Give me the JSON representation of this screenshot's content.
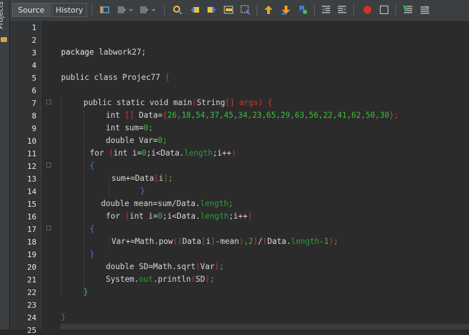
{
  "sidebar": {
    "label": "Projects"
  },
  "tabs": [
    {
      "label": "Source",
      "active": true
    },
    {
      "label": "History",
      "active": false
    }
  ],
  "toolbar_icons": [
    "last-edit-icon",
    "back-icon",
    "forward-icon",
    "find-selection-icon",
    "find-previous-icon",
    "find-next-icon",
    "toggle-highlight-icon",
    "toggle-rect-select-icon",
    "previous-bookmark-icon",
    "next-bookmark-icon",
    "toggle-bookmark-icon",
    "shift-left-icon",
    "shift-right-icon",
    "start-macro-icon",
    "stop-macro-icon",
    "comment-icon",
    "uncomment-icon"
  ],
  "line_numbers": [
    "1",
    "2",
    "3",
    "4",
    "5",
    "6",
    "7",
    "8",
    "9",
    "10",
    "11",
    "12",
    "13",
    "14",
    "15",
    "16",
    "17",
    "18",
    "19",
    "20",
    "21",
    "22",
    "23",
    "24",
    "25"
  ],
  "code": {
    "l3": {
      "kw": "package",
      "rest": " labwork27;"
    },
    "l5": {
      "a": "public class Projec77 ",
      "b": "{"
    },
    "l7": {
      "a": "public static void main",
      "b": "(",
      "c": "String",
      "d": "[]",
      "e": " args",
      "f": ")",
      "g": " {"
    },
    "l8": {
      "a": "int ",
      "b": "[]",
      "c": " Data=",
      "d": "{",
      "e": "26,18,54,37,45,34,23,65,29,63,56,22,41,62,50,30",
      "f": "};"
    },
    "l9": {
      "a": "int sum=",
      "b": "0",
      "c": ";"
    },
    "l10": {
      "a": "double Var=",
      "b": "0",
      "c": ";"
    },
    "l11": {
      "a": "for ",
      "b": "(",
      "c": "int i=",
      "d": "0",
      "e": ";i<Data.",
      "f": "length",
      "g": ";i++",
      "h": ")"
    },
    "l12": {
      "a": "{"
    },
    "l13": {
      "a": "sum+=Data",
      "b": "[",
      "c": "i",
      "d": "]",
      "e": ";"
    },
    "l14": {
      "a": "}"
    },
    "l15": {
      "a": "double mean=sum/Data.",
      "b": "length",
      "c": ";"
    },
    "l16": {
      "a": "for ",
      "b": "(",
      "c": "int i=",
      "d": "0",
      "e": ";i<Data.",
      "f": "length",
      "g": ";i++",
      "h": ")"
    },
    "l17": {
      "a": "{"
    },
    "l18": {
      "a": "Var+=Math.pow",
      "b": "((",
      "c": "Data",
      "d": "[",
      "e": "i",
      "f": "]",
      "g": "-mean",
      "h": ")",
      "i": ",2",
      "j": ")",
      "k": "/",
      "l": "(",
      "m": "Data.",
      "n": "length",
      "o": "-1",
      "p": ")",
      "q": ";"
    },
    "l20": {
      "a": "double SD=Math.sqrt",
      "b": "(",
      "c": "Var",
      "d": ")",
      "e": ";"
    },
    "l21": {
      "a": "System.",
      "b": "out",
      "c": ".println",
      "d": "(",
      "e": "SD",
      "f": ")",
      "g": ";"
    },
    "l22": {
      "a": "}"
    },
    "l24": {
      "a": "}"
    }
  },
  "colors": {
    "background": "#2b2b2b",
    "gutter": "#313335",
    "toolbar": "#3c3f41",
    "bracket": "#cc3b2a",
    "number": "#3fbd3f",
    "field": "#2e9d3a"
  }
}
